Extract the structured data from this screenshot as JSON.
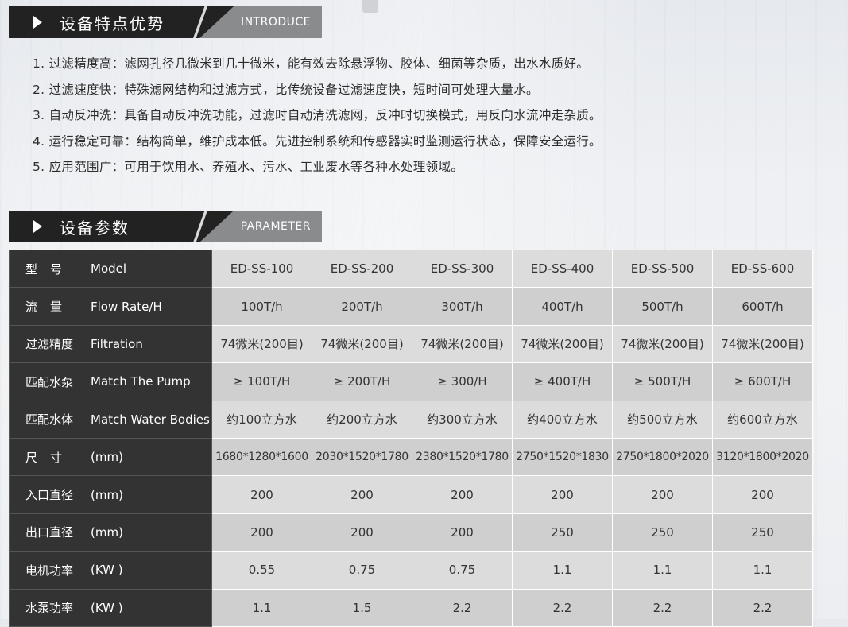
{
  "intro": {
    "title_cn": "设备特点优势",
    "title_en": "INTRODUCE",
    "items": [
      "1. 过滤精度高：滤网孔径几微米到几十微米，能有效去除悬浮物、胶体、细菌等杂质，出水水质好。",
      "2. 过滤速度快：特殊滤网结构和过滤方式，比传统设备过滤速度快，短时间可处理大量水。",
      "3. 自动反冲洗：具备自动反冲洗功能，过滤时自动清洗滤网，反冲时切换模式，用反向水流冲走杂质。",
      "4. 运行稳定可靠：结构简单，维护成本低。先进控制系统和传感器实时监测运行状态，保障安全运行。",
      "5. 应用范围广：可用于饮用水、养殖水、污水、工业废水等各种水处理领域。"
    ]
  },
  "parameter": {
    "title_cn": "设备参数",
    "title_en": "PARAMETER",
    "rows": [
      {
        "cn": [
          "型",
          "号"
        ],
        "en": "Model",
        "values": [
          "ED-SS-100",
          "ED-SS-200",
          "ED-SS-300",
          "ED-SS-400",
          "ED-SS-500",
          "ED-SS-600"
        ]
      },
      {
        "cn": [
          "流",
          "量"
        ],
        "en": "Flow Rate/H",
        "values": [
          "100T/h",
          "200T/h",
          "300T/h",
          "400T/h",
          "500T/h",
          "600T/h"
        ]
      },
      {
        "cn": [
          "过滤精度"
        ],
        "en": "Filtration",
        "values": [
          "74微米(200目)",
          "74微米(200目)",
          "74微米(200目)",
          "74微米(200目)",
          "74微米(200目)",
          "74微米(200目)"
        ]
      },
      {
        "cn": [
          "匹配水泵"
        ],
        "en": "Match The Pump",
        "values": [
          "≥ 100T/H",
          "≥ 200T/H",
          "≥ 300/H",
          "≥ 400T/H",
          "≥ 500T/H",
          "≥ 600T/H"
        ]
      },
      {
        "cn": [
          "匹配水体"
        ],
        "en": "Match Water Bodies",
        "values": [
          "约100立方水",
          "约200立方水",
          "约300立方水",
          "约400立方水",
          "约500立方水",
          "约600立方水"
        ]
      },
      {
        "cn": [
          "尺",
          "寸"
        ],
        "en": "(mm)",
        "values": [
          "1680*1280*1600",
          "2030*1520*1780",
          "2380*1520*1780",
          "2750*1520*1830",
          "2750*1800*2020",
          "3120*1800*2020"
        ]
      },
      {
        "cn": [
          "入口直径"
        ],
        "en": "(mm)",
        "values": [
          "200",
          "200",
          "200",
          "200",
          "200",
          "200"
        ]
      },
      {
        "cn": [
          "出口直径"
        ],
        "en": "(mm)",
        "values": [
          "200",
          "200",
          "200",
          "250",
          "250",
          "250"
        ]
      },
      {
        "cn": [
          "电机功率"
        ],
        "en": "(KW )",
        "values": [
          "0.55",
          "0.75",
          "0.75",
          "1.1",
          "1.1",
          "1.1"
        ]
      },
      {
        "cn": [
          "水泵功率"
        ],
        "en": "(KW )",
        "values": [
          "1.1",
          "1.5",
          "2.2",
          "2.2",
          "2.2",
          "2.2"
        ]
      }
    ]
  }
}
